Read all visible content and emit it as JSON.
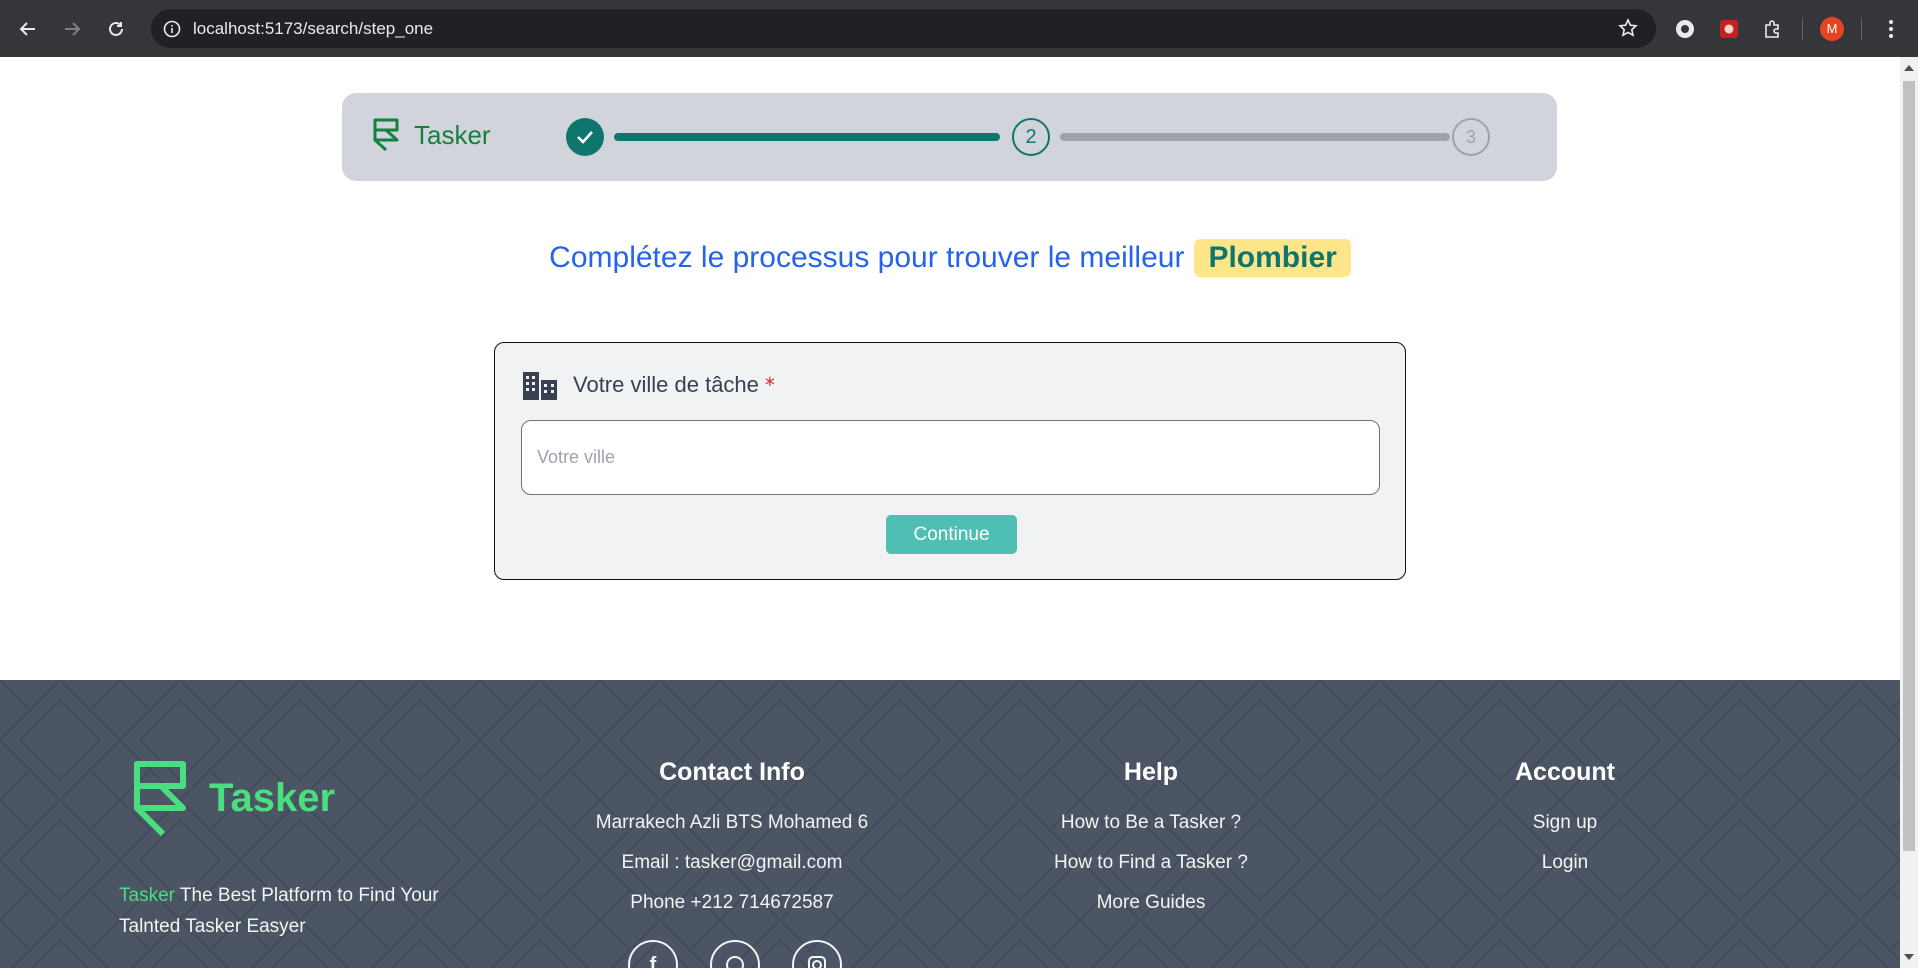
{
  "browser": {
    "url": "localhost:5173/search/step_one",
    "profile_initial": "M"
  },
  "header": {
    "brand": "Tasker",
    "steps": [
      {
        "label": "",
        "status": "done"
      },
      {
        "label": "2",
        "status": "current"
      },
      {
        "label": "3",
        "status": "upcoming"
      }
    ]
  },
  "headline": {
    "text": "Complétez le processus pour trouver le meilleur",
    "job": "Plombier"
  },
  "form": {
    "label": "Votre ville de tâche",
    "required_mark": "*",
    "city_placeholder": "Votre ville",
    "city_value": "",
    "continue_label": "Continue"
  },
  "footer": {
    "brand": "Tasker",
    "desc_highlight": "Tasker",
    "desc_rest": " The Best Platform to Find Your Talnted Tasker Easyer",
    "contact": {
      "title": "Contact Info",
      "address": "Marrakech Azli BTS Mohamed 6",
      "email": "Email : tasker@gmail.com",
      "phone": "Phone +212 714672587"
    },
    "help": {
      "title": "Help",
      "links": [
        "How to Be a Tasker ?",
        "How to Find a Tasker ?",
        "More Guides"
      ]
    },
    "account": {
      "title": "Account",
      "links": [
        "Sign up",
        "Login"
      ]
    },
    "socials": [
      "facebook-icon",
      "whatsapp-icon",
      "instagram-icon"
    ]
  },
  "colors": {
    "brand_green": "#15803d",
    "accent_teal": "#0f766e",
    "headline_blue": "#2563eb",
    "badge_yellow": "#fde68a",
    "footer_bg": "#4b5563"
  }
}
